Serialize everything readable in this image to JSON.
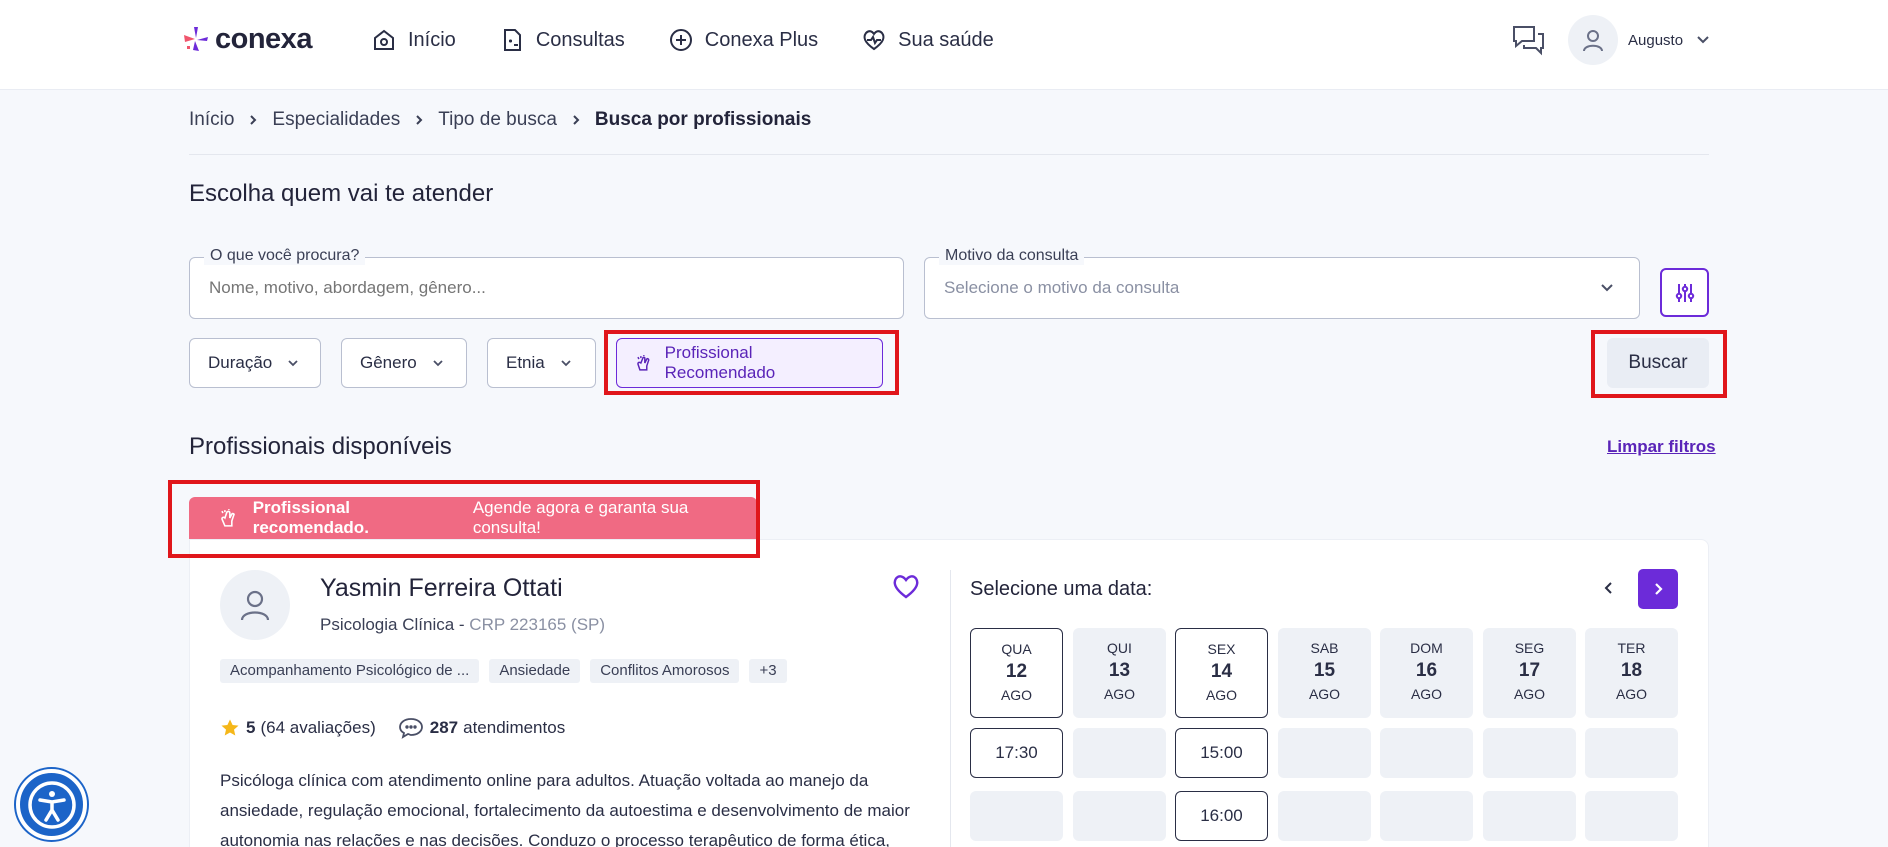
{
  "brand": {
    "logo_text": "conexa"
  },
  "nav": [
    {
      "label": "Início",
      "icon": "home-icon"
    },
    {
      "label": "Consultas",
      "icon": "consultations-icon"
    },
    {
      "label": "Conexa Plus",
      "icon": "plus-circle-icon"
    },
    {
      "label": "Sua saúde",
      "icon": "heart-pulse-icon"
    }
  ],
  "user": {
    "name": "Augusto"
  },
  "breadcrumb": [
    "Início",
    "Especialidades",
    "Tipo de busca",
    "Busca por profissionais"
  ],
  "search": {
    "title": "Escolha quem vai te atender",
    "query_label": "O que você procura?",
    "query_placeholder": "Nome, motivo, abordagem, gênero...",
    "reason_label": "Motivo da consulta",
    "reason_placeholder": "Selecione o motivo da consulta",
    "filters": [
      "Duração",
      "Gênero",
      "Etnia"
    ],
    "recommended_label": "Profissional Recomendado",
    "search_button": "Buscar"
  },
  "results": {
    "title": "Profissionais disponíveis",
    "clear_filters": "Limpar filtros",
    "banner_bold": "Profissional recomendado.",
    "banner_text": "Agende agora e garanta sua consulta!"
  },
  "professional": {
    "name": "Yasmin Ferreira Ottati",
    "specialty": "Psicologia Clínica",
    "separator": " - ",
    "crp": "CRP 223165 (SP)",
    "tags": [
      "Acompanhamento Psicológico de ...",
      "Ansiedade",
      "Conflitos Amorosos",
      "+3"
    ],
    "rating": "5",
    "reviews": "(64 avaliações)",
    "appointments_count": "287",
    "appointments_label": "atendimentos",
    "description": "Psicóloga clínica com atendimento online para adultos. Atuação voltada ao manejo da ansiedade, regulação emocional, fortalecimento da autoestima e desenvolvimento de maior autonomia nas relações e nas decisões. Conduzo o processo terapêutico de forma ética,"
  },
  "schedule": {
    "title": "Selecione uma data:",
    "days": [
      {
        "weekday": "QUA",
        "day": "12",
        "month": "AGO",
        "available": true,
        "slots": [
          "17:30",
          ""
        ]
      },
      {
        "weekday": "QUI",
        "day": "13",
        "month": "AGO",
        "available": false,
        "slots": [
          "",
          ""
        ]
      },
      {
        "weekday": "SEX",
        "day": "14",
        "month": "AGO",
        "available": true,
        "slots": [
          "15:00",
          "16:00"
        ]
      },
      {
        "weekday": "SAB",
        "day": "15",
        "month": "AGO",
        "available": false,
        "slots": [
          "",
          ""
        ]
      },
      {
        "weekday": "DOM",
        "day": "16",
        "month": "AGO",
        "available": false,
        "slots": [
          "",
          ""
        ]
      },
      {
        "weekday": "SEG",
        "day": "17",
        "month": "AGO",
        "available": false,
        "slots": [
          "",
          ""
        ]
      },
      {
        "weekday": "TER",
        "day": "18",
        "month": "AGO",
        "available": false,
        "slots": [
          "",
          ""
        ]
      }
    ]
  },
  "colors": {
    "accent": "#6c2bd9",
    "banner": "#f06a83",
    "highlight": "#e0161b",
    "a11y": "#1c64c8"
  }
}
